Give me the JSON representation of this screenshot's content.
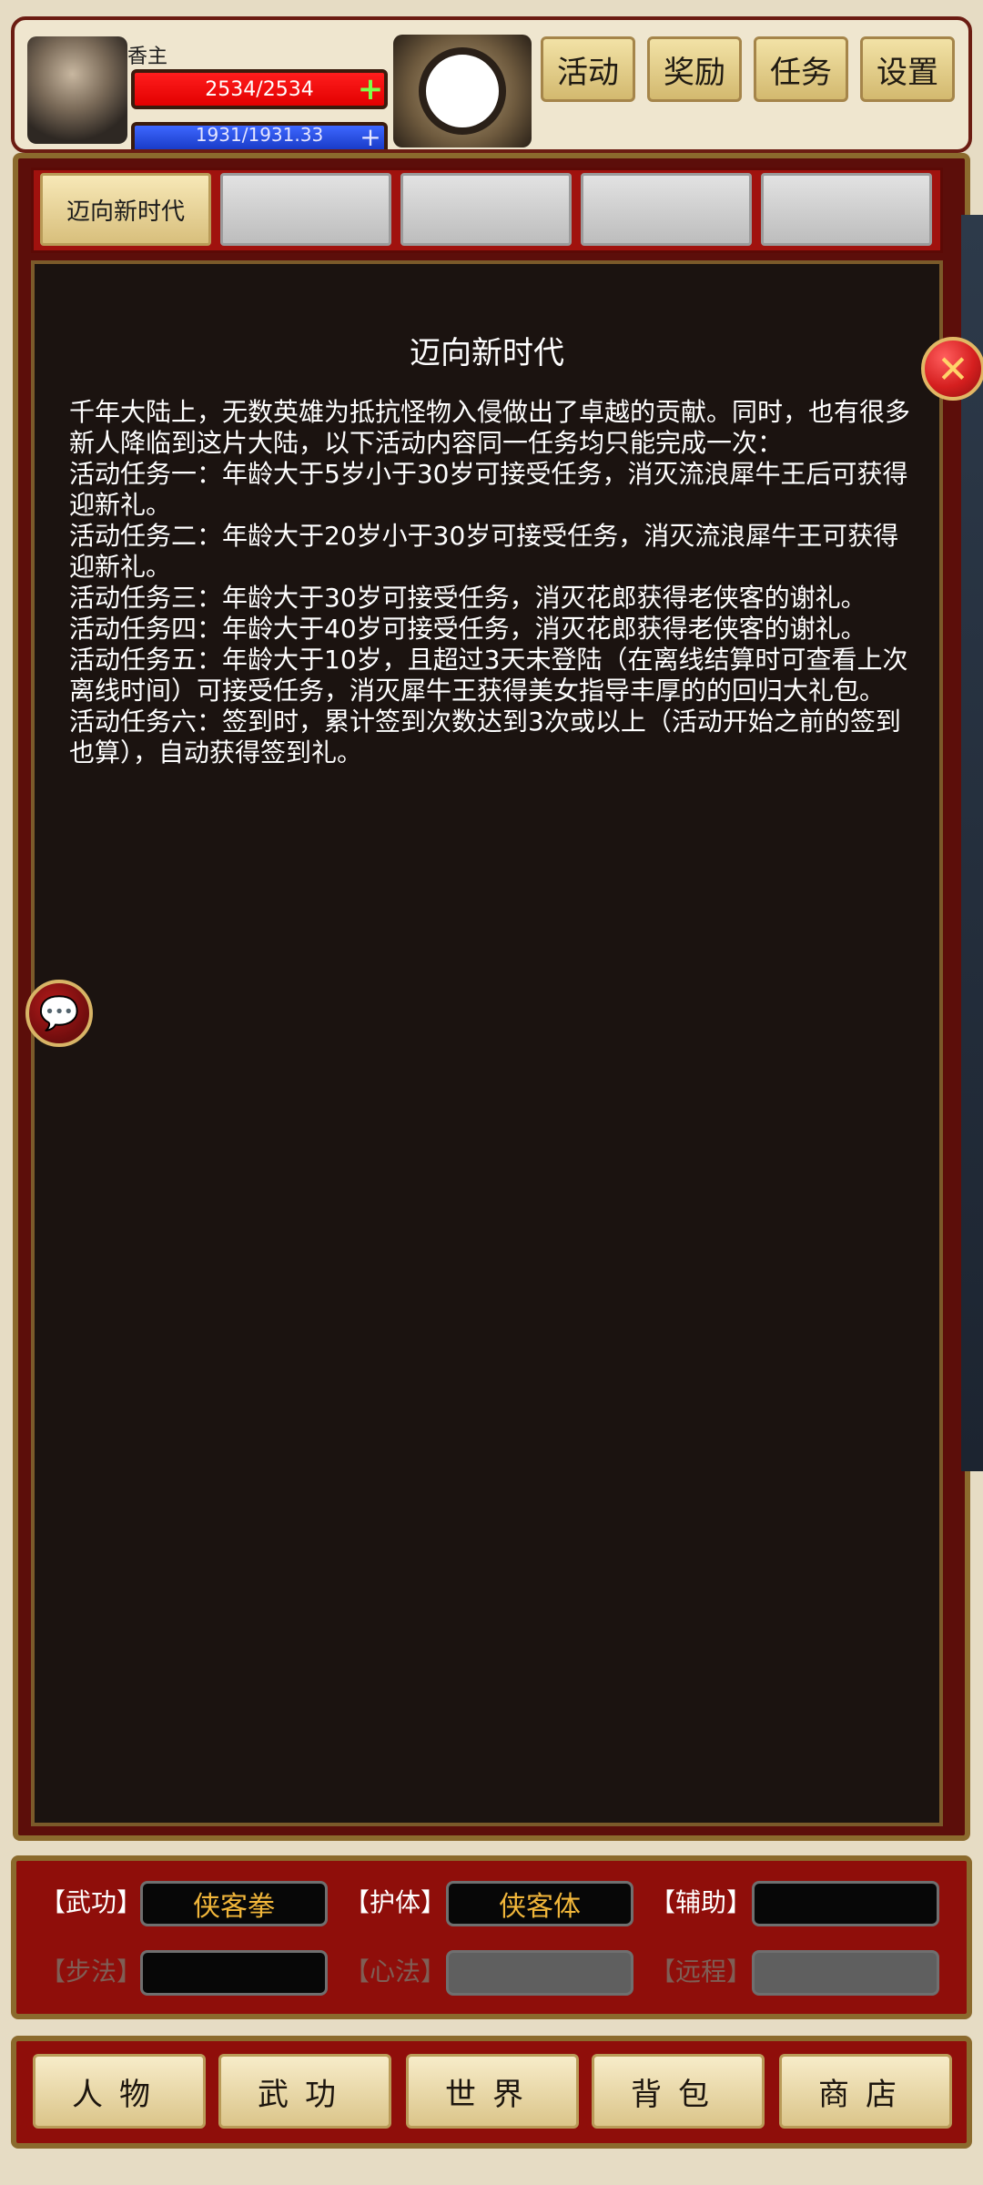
{
  "header": {
    "player_name": "香主",
    "hp_text": "2534/2534",
    "mp_text": "1931/1931.33",
    "top_buttons": [
      "活动",
      "奖励",
      "任务",
      "设置"
    ]
  },
  "tabs": [
    {
      "label": "迈向新时代",
      "active": true
    },
    {
      "label": "",
      "active": false
    },
    {
      "label": "",
      "active": false
    },
    {
      "label": "",
      "active": false
    },
    {
      "label": "",
      "active": false
    }
  ],
  "content": {
    "title": "迈向新时代",
    "paragraphs": [
      "千年大陆上，无数英雄为抵抗怪物入侵做出了卓越的贡献。同时，也有很多新人降临到这片大陆，以下活动内容同一任务均只能完成一次：",
      "活动任务一：年龄大于5岁小于30岁可接受任务，消灭流浪犀牛王后可获得迎新礼。",
      "活动任务二：年龄大于20岁小于30岁可接受任务，消灭流浪犀牛王可获得迎新礼。",
      "活动任务三：年龄大于30岁可接受任务，消灭花郎获得老侠客的谢礼。",
      "活动任务四：年龄大于40岁可接受任务，消灭花郎获得老侠客的谢礼。",
      "活动任务五：年龄大于10岁，且超过3天未登陆（在离线结算时可查看上次离线时间）可接受任务，消灭犀牛王获得美女指导丰厚的的回归大礼包。",
      "活动任务六：签到时，累计签到次数达到3次或以上（活动开始之前的签到也算），自动获得签到礼。"
    ]
  },
  "icons": {
    "close": "close-icon",
    "chat": "chat-icon",
    "hp_plus": "+",
    "mp_plus": "+"
  },
  "skills": {
    "row1": [
      {
        "label": "【武功】",
        "value": "侠客拳"
      },
      {
        "label": "【护体】",
        "value": "侠客体"
      },
      {
        "label": "【辅助】",
        "value": ""
      }
    ],
    "row2": [
      {
        "label": "【步法】",
        "value": ""
      },
      {
        "label": "【心法】",
        "value": ""
      },
      {
        "label": "【远程】",
        "value": ""
      }
    ]
  },
  "nav": [
    "人物",
    "武功",
    "世界",
    "背包",
    "商店"
  ],
  "colors": {
    "accent_red": "#a0120e",
    "gold": "#d8bf7c",
    "hp_red": "#e20000",
    "mp_blue": "#1a3cc8",
    "skill_gold_text": "#f1b63a"
  }
}
